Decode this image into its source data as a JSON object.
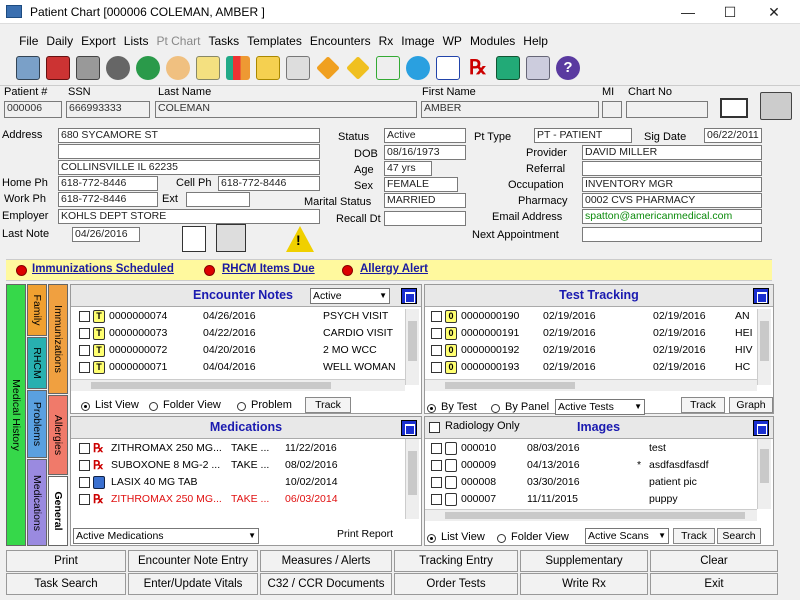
{
  "window": {
    "title": "Patient Chart [000006 COLEMAN, AMBER ]",
    "min": "—",
    "max": "☐",
    "close": "✕"
  },
  "menu": [
    "File",
    "Daily",
    "Export",
    "Lists",
    "Pt Chart",
    "Tasks",
    "Templates",
    "Encounters",
    "Rx",
    "Image",
    "WP",
    "Modules",
    "Help"
  ],
  "header": {
    "patient_no_label": "Patient #",
    "patient_no": "000006",
    "ssn_label": "SSN",
    "ssn": "666993333",
    "last_name_label": "Last Name",
    "last_name": "COLEMAN",
    "first_name_label": "First Name",
    "first_name": "AMBER",
    "mi_label": "MI",
    "mi": "",
    "chart_no_label": "Chart No",
    "chart_no": ""
  },
  "demo": {
    "address_label": "Address",
    "address1": "680 SYCAMORE ST",
    "address2": "",
    "city": "COLLINSVILLE  IL  62235",
    "home_ph_label": "Home Ph",
    "home_ph": "618-772-8446",
    "cell_ph_label": "Cell Ph",
    "cell_ph": "618-772-8446",
    "work_ph_label": "Work Ph",
    "work_ph": "618-772-8446",
    "ext_label": "Ext",
    "ext": "",
    "employer_label": "Employer",
    "employer": "KOHLS DEPT STORE",
    "last_note_label": "Last Note",
    "last_note": "04/26/2016",
    "status_label": "Status",
    "status": "Active",
    "dob_label": "DOB",
    "dob": "08/16/1973",
    "age_label": "Age",
    "age": "47 yrs",
    "sex_label": "Sex",
    "sex": "FEMALE",
    "marital_label": "Marital Status",
    "marital": "MARRIED",
    "recall_label": "Recall Dt",
    "recall": "",
    "pt_type_label": "Pt Type",
    "pt_type": "PT - PATIENT",
    "sig_date_label": "Sig Date",
    "sig_date": "06/22/2011",
    "provider_label": "Provider",
    "provider": "DAVID  MILLER",
    "referral_label": "Referral",
    "referral": "",
    "occupation_label": "Occupation",
    "occupation": "INVENTORY MGR",
    "pharmacy_label": "Pharmacy",
    "pharmacy": "0002 CVS PHARMACY",
    "email_label": "Email Address",
    "email": "spatton@americanmedical.com",
    "next_appt_label": "Next Appointment",
    "next_appt": ""
  },
  "alerts": [
    "Immunizations Scheduled",
    "RHCM Items Due",
    "Allergy Alert"
  ],
  "side_tabs": {
    "outer": "Medical History",
    "family": "Family",
    "rhcm": "RHCM",
    "problems": "Problems",
    "medications": "Medications",
    "immunizations": "Immunizations",
    "allergies": "Allergies",
    "general": "General"
  },
  "encounters": {
    "title": "Encounter Notes",
    "filter": "Active",
    "rows": [
      {
        "num": "0000000074",
        "date": "04/26/2016",
        "desc": "PSYCH VISIT"
      },
      {
        "num": "0000000073",
        "date": "04/22/2016",
        "desc": "CARDIO VISIT"
      },
      {
        "num": "0000000072",
        "date": "04/20/2016",
        "desc": "2 MO WCC"
      },
      {
        "num": "0000000071",
        "date": "04/04/2016",
        "desc": "WELL WOMAN"
      }
    ],
    "list_view": "List View",
    "folder_view": "Folder View",
    "problem": "Problem",
    "track": "Track"
  },
  "tests": {
    "title": "Test Tracking",
    "rows": [
      {
        "num": "0000000190",
        "date1": "02/19/2016",
        "date2": "02/19/2016",
        "desc": "AN"
      },
      {
        "num": "0000000191",
        "date1": "02/19/2016",
        "date2": "02/19/2016",
        "desc": "HEI"
      },
      {
        "num": "0000000192",
        "date1": "02/19/2016",
        "date2": "02/19/2016",
        "desc": "HIV"
      },
      {
        "num": "0000000193",
        "date1": "02/19/2016",
        "date2": "02/19/2016",
        "desc": "HC"
      }
    ],
    "by_test": "By Test",
    "by_panel": "By Panel",
    "filter": "Active Tests",
    "track": "Track",
    "graph": "Graph"
  },
  "medications": {
    "title": "Medications",
    "rows": [
      {
        "name": "ZITHROMAX 250 MG...",
        "sig": "TAKE ...",
        "date": "11/22/2016",
        "red": false,
        "icon": "rx"
      },
      {
        "name": "SUBOXONE 8 MG-2 ...",
        "sig": "TAKE ...",
        "date": "08/02/2016",
        "red": false,
        "icon": "rx"
      },
      {
        "name": "LASIX 40 MG TAB",
        "sig": "",
        "date": "10/02/2014",
        "red": false,
        "icon": "cart"
      },
      {
        "name": "ZITHROMAX 250 MG...",
        "sig": "TAKE ...",
        "date": "06/03/2014",
        "red": true,
        "icon": "rx"
      }
    ],
    "filter": "Active Medications",
    "print": "Print Report"
  },
  "images": {
    "title": "Images",
    "radiology": "Radiology Only",
    "rows": [
      {
        "num": "000010",
        "date": "08/03/2016",
        "flag": "",
        "desc": "test"
      },
      {
        "num": "000009",
        "date": "04/13/2016",
        "flag": "*",
        "desc": "asdfasdfasdf"
      },
      {
        "num": "000008",
        "date": "03/30/2016",
        "flag": "",
        "desc": "patient pic"
      },
      {
        "num": "000007",
        "date": "11/11/2015",
        "flag": "",
        "desc": "puppy"
      }
    ],
    "list_view": "List View",
    "folder_view": "Folder View",
    "filter": "Active Scans",
    "track": "Track",
    "search": "Search"
  },
  "buttons": {
    "row1": [
      "Print",
      "Encounter Note Entry",
      "Measures / Alerts",
      "Tracking Entry",
      "Supplementary",
      "Clear"
    ],
    "row2": [
      "Task Search",
      "Enter/Update Vitals",
      "C32 / CCR Documents",
      "Order Tests",
      "Write Rx",
      "Exit"
    ]
  },
  "colors": {
    "alert_bar": "#fff99e",
    "panel_title": "#1a1ab0",
    "link": "#1a1aa0",
    "email": "#0a8a0a",
    "med_red": "#e01010"
  }
}
